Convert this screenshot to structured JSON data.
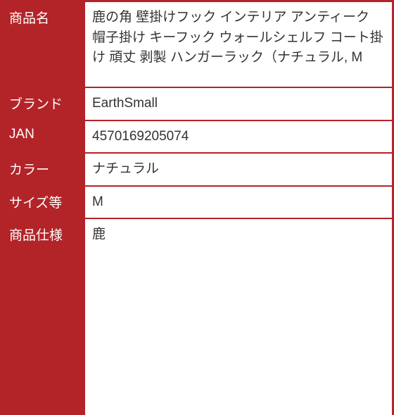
{
  "rows": [
    {
      "label": "商品名",
      "value": "鹿の角 壁掛けフック インテリア アンティーク 帽子掛け キーフック ウォールシェルフ コート掛け 頑丈 剥製 ハンガーラック（ナチュラル, M"
    },
    {
      "label": "ブランド",
      "value": "EarthSmall"
    },
    {
      "label": "JAN",
      "value": "4570169205074"
    },
    {
      "label": "カラー",
      "value": "ナチュラル"
    },
    {
      "label": "サイズ等",
      "value": "M"
    },
    {
      "label": "商品仕様",
      "value": "鹿"
    }
  ]
}
